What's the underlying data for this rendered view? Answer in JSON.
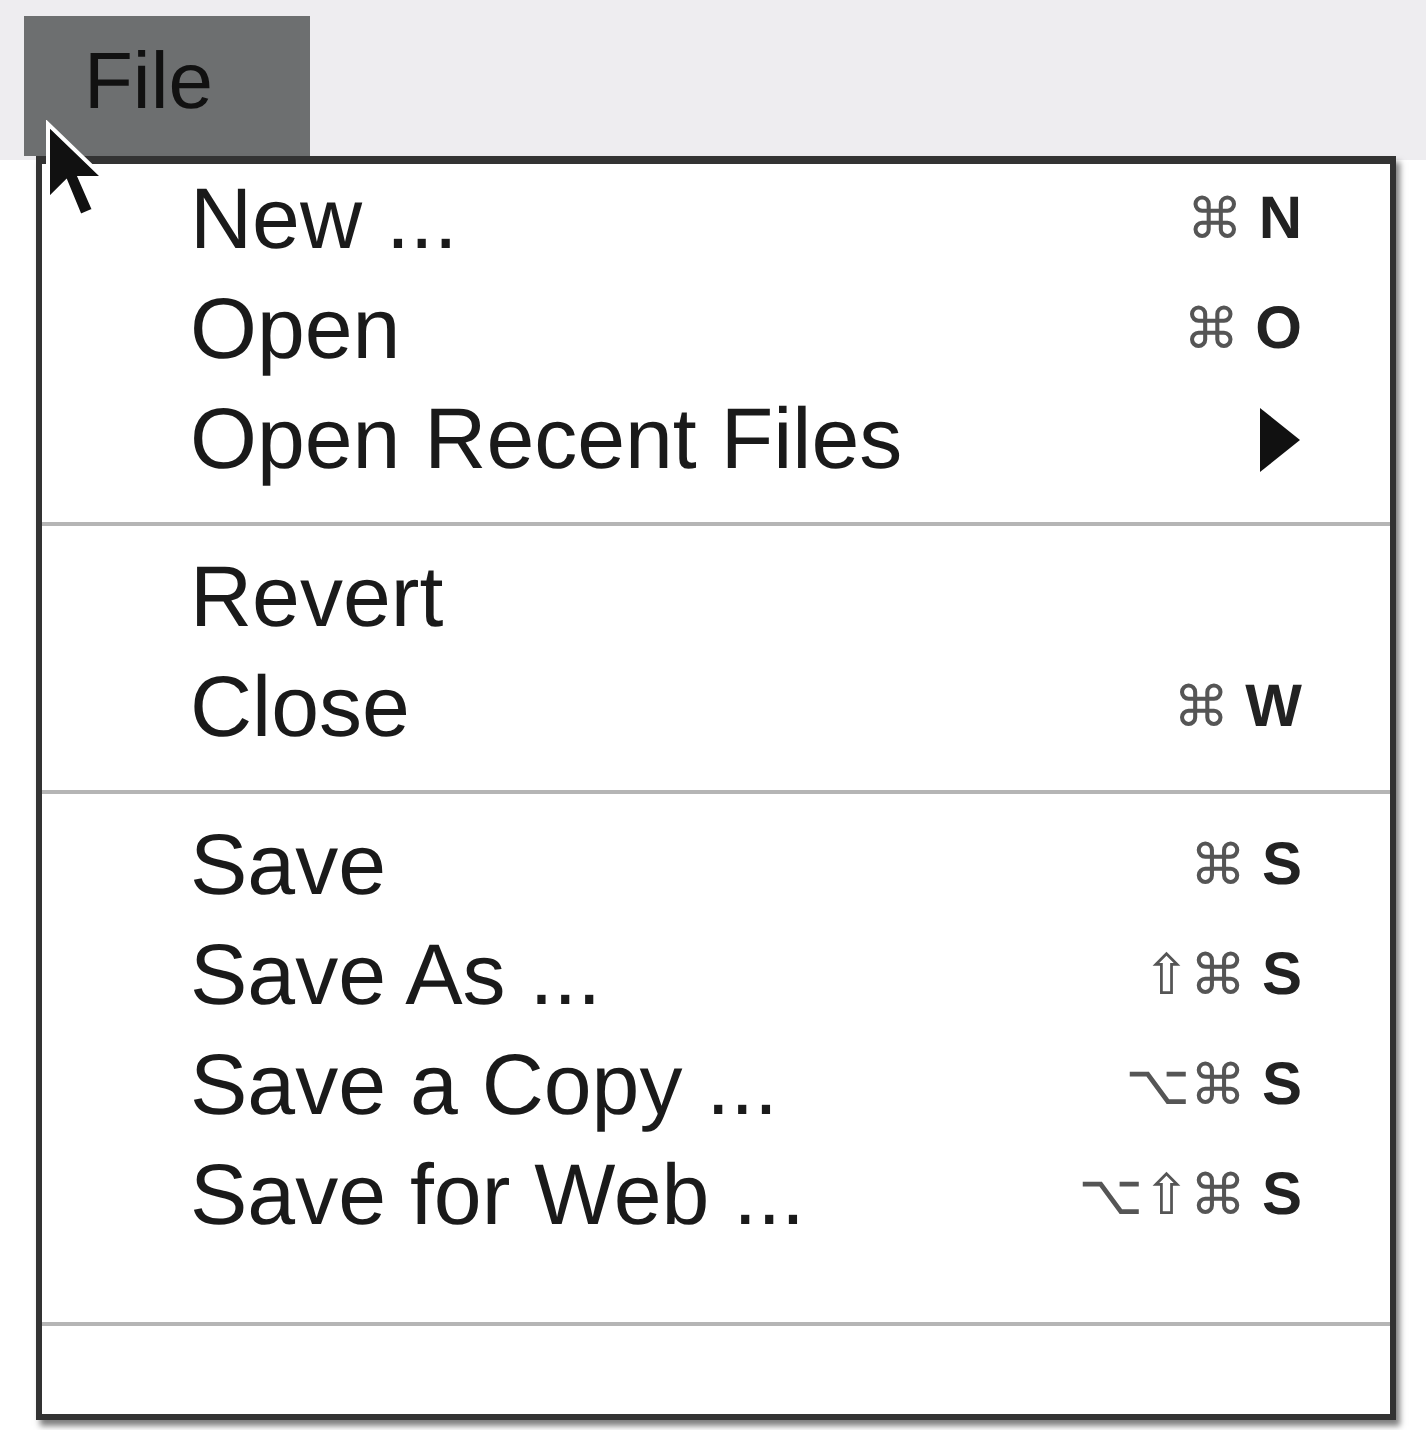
{
  "menu_bar": {
    "title": "File",
    "selected": true
  },
  "groups": [
    [
      {
        "label": "New ...",
        "modifiers": "⌘",
        "key": "N"
      },
      {
        "label": "Open",
        "modifiers": "⌘",
        "key": "O"
      },
      {
        "label": "Open Recent Files",
        "has_submenu": true
      }
    ],
    [
      {
        "label": "Revert"
      },
      {
        "label": "Close",
        "modifiers": "⌘",
        "key": "W"
      }
    ],
    [
      {
        "label": "Save",
        "modifiers": "⌘",
        "key": "S"
      },
      {
        "label": "Save As ...",
        "modifiers": "⇧⌘",
        "key": "S"
      },
      {
        "label": "Save a Copy ...",
        "modifiers": "⌥⌘",
        "key": "S"
      },
      {
        "label": "Save for Web ...",
        "modifiers": "⌥⇧⌘",
        "key": "S"
      }
    ]
  ]
}
